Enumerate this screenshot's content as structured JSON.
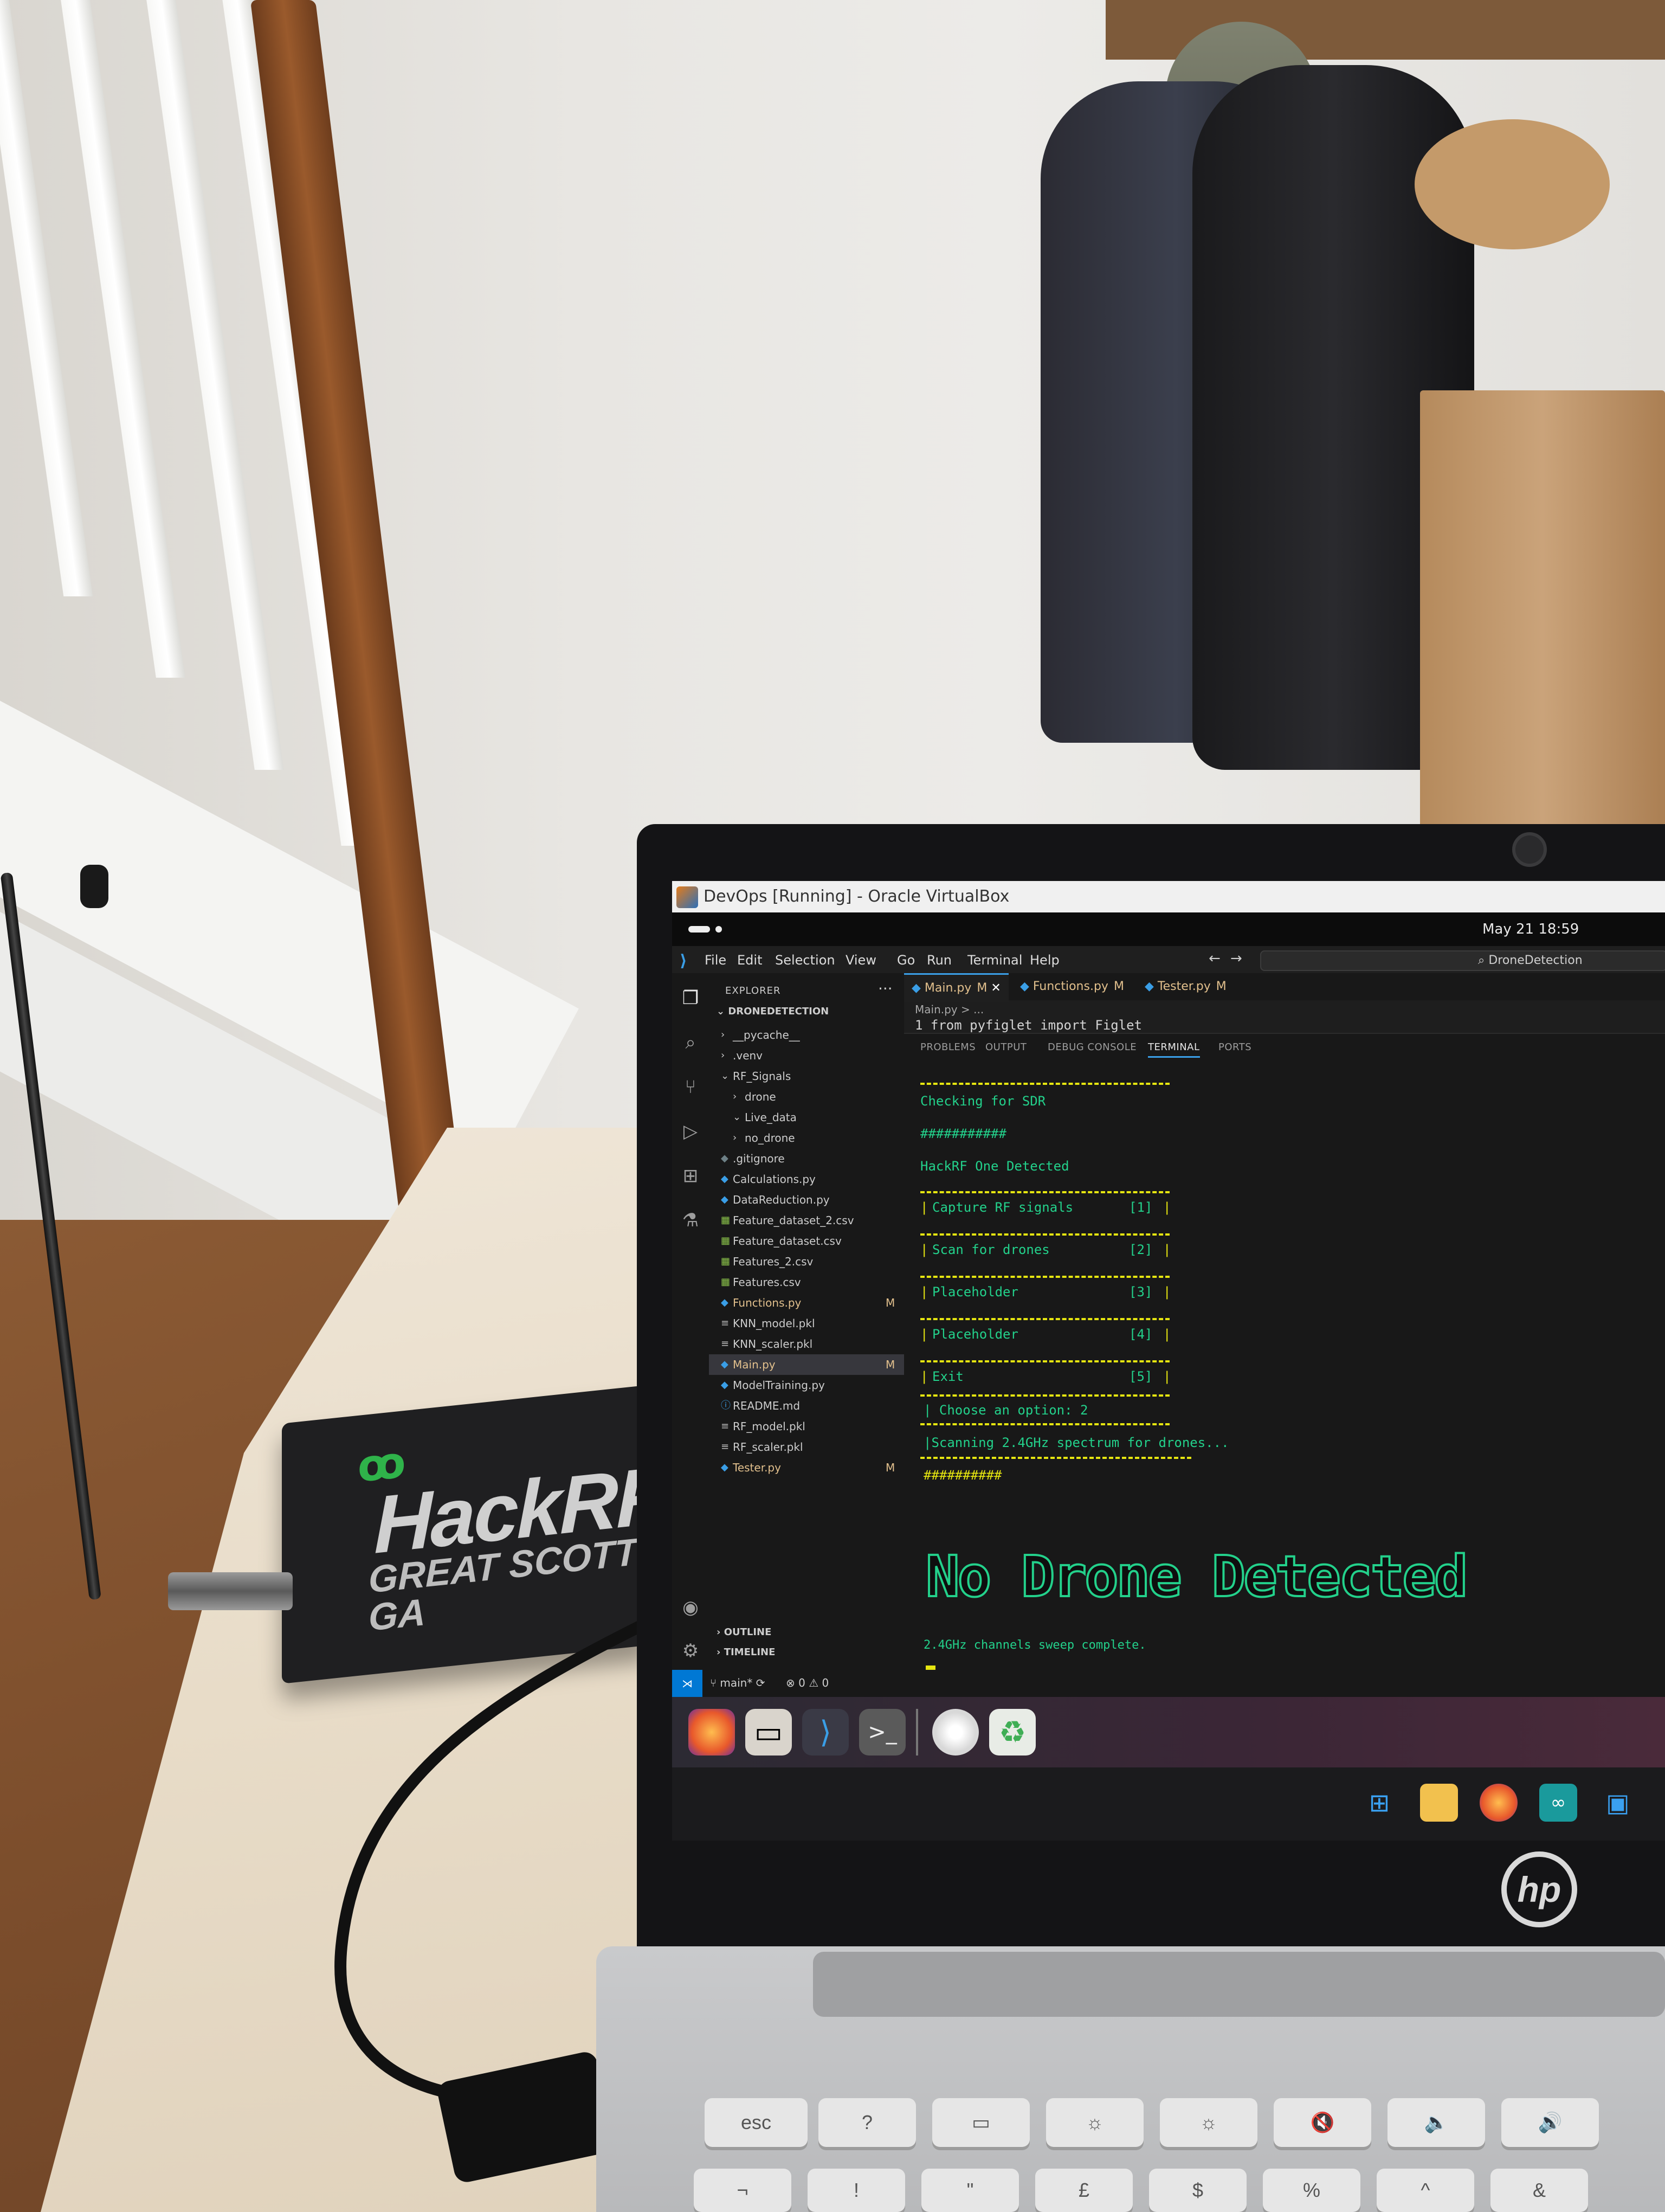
{
  "virtualbox": {
    "title": "DevOps [Running] - Oracle VirtualBox"
  },
  "gnome": {
    "clock": "May 21  18:59"
  },
  "vscode": {
    "menu": [
      "File",
      "Edit",
      "Selection",
      "View",
      "Go",
      "Run",
      "Terminal",
      "Help"
    ],
    "search_text": "DroneDetection",
    "explorer_title": "EXPLORER",
    "explorer_root": "DRONEDETECTION",
    "tree": [
      {
        "label": "__pycache__",
        "indent": 1,
        "kind": "folder-closed",
        "badge": ""
      },
      {
        "label": ".venv",
        "indent": 1,
        "kind": "folder-closed",
        "badge": ""
      },
      {
        "label": "RF_Signals",
        "indent": 1,
        "kind": "folder-open",
        "badge": ""
      },
      {
        "label": "drone",
        "indent": 2,
        "kind": "folder-closed",
        "badge": ""
      },
      {
        "label": "Live_data",
        "indent": 2,
        "kind": "folder-open",
        "badge": ""
      },
      {
        "label": "no_drone",
        "indent": 2,
        "kind": "folder-closed",
        "badge": ""
      },
      {
        "label": ".gitignore",
        "indent": 1,
        "kind": "file-git",
        "badge": ""
      },
      {
        "label": "Calculations.py",
        "indent": 1,
        "kind": "file-py",
        "badge": ""
      },
      {
        "label": "DataReduction.py",
        "indent": 1,
        "kind": "file-py",
        "badge": ""
      },
      {
        "label": "Feature_dataset_2.csv",
        "indent": 1,
        "kind": "file-csv",
        "badge": ""
      },
      {
        "label": "Feature_dataset.csv",
        "indent": 1,
        "kind": "file-csv",
        "badge": ""
      },
      {
        "label": "Features_2.csv",
        "indent": 1,
        "kind": "file-csv",
        "badge": ""
      },
      {
        "label": "Features.csv",
        "indent": 1,
        "kind": "file-csv",
        "badge": ""
      },
      {
        "label": "Functions.py",
        "indent": 1,
        "kind": "file-py-mod",
        "badge": "M"
      },
      {
        "label": "KNN_model.pkl",
        "indent": 1,
        "kind": "file-pkl",
        "badge": ""
      },
      {
        "label": "KNN_scaler.pkl",
        "indent": 1,
        "kind": "file-pkl",
        "badge": ""
      },
      {
        "label": "Main.py",
        "indent": 1,
        "kind": "file-py-mod",
        "badge": "M",
        "selected": true
      },
      {
        "label": "ModelTraining.py",
        "indent": 1,
        "kind": "file-py",
        "badge": ""
      },
      {
        "label": "README.md",
        "indent": 1,
        "kind": "file-md",
        "badge": ""
      },
      {
        "label": "RF_model.pkl",
        "indent": 1,
        "kind": "file-pkl",
        "badge": ""
      },
      {
        "label": "RF_scaler.pkl",
        "indent": 1,
        "kind": "file-pkl",
        "badge": ""
      },
      {
        "label": "Tester.py",
        "indent": 1,
        "kind": "file-py-mod",
        "badge": "M"
      }
    ],
    "outline": "OUTLINE",
    "timeline": "TIMELINE",
    "tabs": [
      {
        "label": "Main.py",
        "mod": "M",
        "active": true
      },
      {
        "label": "Functions.py",
        "mod": "M",
        "active": false
      },
      {
        "label": "Tester.py",
        "mod": "M",
        "active": false
      }
    ],
    "breadcrumb": "Main.py > ...",
    "code_line": "1   from pyfiglet import Figlet",
    "panel_tabs": [
      "PROBLEMS",
      "OUTPUT",
      "DEBUG CONSOLE",
      "TERMINAL",
      "PORTS"
    ],
    "panel_active": "TERMINAL",
    "status": {
      "branch": "main*",
      "problems": "⊗ 0 ⚠ 0"
    }
  },
  "terminal": {
    "checking": "Checking for SDR",
    "hashes1": "###########",
    "detected": "HackRF One Detected",
    "menu": [
      {
        "label": "Capture RF signals",
        "key": "[1]"
      },
      {
        "label": "Scan for drones",
        "key": "[2]"
      },
      {
        "label": "Placeholder",
        "key": "[3]"
      },
      {
        "label": "Placeholder",
        "key": "[4]"
      },
      {
        "label": "Exit",
        "key": "[5]"
      }
    ],
    "prompt": "| Choose an option: 2",
    "scanning": "|Scanning 2.4GHz spectrum for drones...",
    "hashes2": "##########",
    "figlet": "No Drone Detected",
    "sweep": "2.4GHz channels sweep complete."
  },
  "hardware": {
    "hackrf_name": "HackRF",
    "hackrf_brand": "GREAT SCOTT GA",
    "laptop_logo": "hp",
    "keys": [
      "esc",
      "?",
      "▭",
      "☼",
      "☼",
      "🔇",
      "🔈",
      "🔊"
    ],
    "keys_row2": [
      "¬",
      "!",
      "\"",
      "£",
      "$",
      "%",
      "^",
      "&"
    ]
  },
  "colors": {
    "terminal_yellow": "#e5e510",
    "terminal_green": "#23d18b",
    "vscode_accent": "#3a9ee6"
  }
}
